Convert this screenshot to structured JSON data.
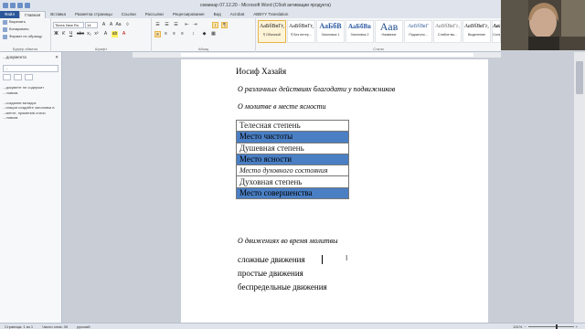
{
  "window": {
    "title": "семинар 07.12.20 - Microsoft Word (Сбой активации продукта)"
  },
  "tabs": [
    {
      "label": "Главная",
      "active": true,
      "file": true
    },
    {
      "label": "Вставка"
    },
    {
      "label": "Разметка страницы"
    },
    {
      "label": "Ссылки"
    },
    {
      "label": "Рассылки"
    },
    {
      "label": "Рецензирование"
    },
    {
      "label": "Вид"
    },
    {
      "label": "Acrobat"
    },
    {
      "label": "ABBYY Translation"
    }
  ],
  "ribbon": {
    "clipboard": {
      "cut": "Вырезать",
      "copy": "Копировать",
      "format_painter": "Формат по образцу",
      "group_label": "Буфер обмена"
    },
    "font": {
      "name": "Times New Ro",
      "size": "14",
      "group_label": "Шрифт"
    },
    "paragraph": {
      "group_label": "Абзац"
    },
    "styles": {
      "group_label": "Стили",
      "items": [
        {
          "preview": "АаБбВвГг,",
          "name": "¶ Обычный",
          "selected": true
        },
        {
          "preview": "АаБбВвГг,",
          "name": "¶ Без интер..."
        },
        {
          "preview": "АаБбВ",
          "name": "Заголовок 1"
        },
        {
          "preview": "АаБбВв",
          "name": "Заголовок 2"
        },
        {
          "preview": "Аав",
          "name": "Название"
        },
        {
          "preview": "АаБбВвГ",
          "name": "Подзаголо..."
        },
        {
          "preview": "АаБбВвГг,",
          "name": "Слабое вы..."
        },
        {
          "preview": "АаБбВвГг,",
          "name": "Выделение"
        },
        {
          "preview": "АаБбВв",
          "name": "Сильн..."
        }
      ]
    }
  },
  "navpane": {
    "title": "...документа",
    "search_placeholder": "...",
    "text": "...документ не содержит\n...ловков.\n\n...создания вкладок\n...игации создайте заголовки в\n...менте, применив стили\n...ловков."
  },
  "document": {
    "author": "Иосиф Хазайя",
    "heading1": "О различных действиях благодати у подвижников",
    "heading2": "О молитве в месте ясности",
    "table": [
      {
        "text": "Телесная степень",
        "highlight": false,
        "italic": false
      },
      {
        "text": "Место чистоты",
        "highlight": true,
        "italic": false
      },
      {
        "text": "Душевная степень",
        "highlight": false,
        "italic": false
      },
      {
        "text": "Место ясности",
        "highlight": true,
        "italic": false
      },
      {
        "text": "Место духовного состояния",
        "highlight": false,
        "italic": true
      },
      {
        "text": "Духовная степень",
        "highlight": false,
        "italic": false
      },
      {
        "text": "Место совершенства",
        "highlight": true,
        "italic": false
      }
    ],
    "heading3": "О движениях во время молитвы",
    "list": [
      "сложные движения",
      "простые движения",
      "беспредельные движения"
    ]
  },
  "statusbar": {
    "page": "Страница: 1 из 1",
    "words": "Число слов: 39",
    "language": "русский",
    "zoom": "131%"
  },
  "colors": {
    "highlight": "#4a7fc4",
    "file_tab": "#2b579a",
    "ribbon_bg": "#f5f6f7",
    "doc_bg": "#c9ced6"
  }
}
